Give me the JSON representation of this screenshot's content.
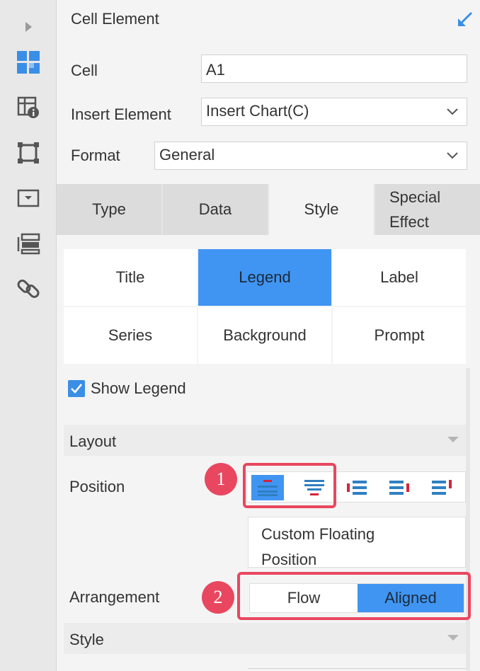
{
  "header": {
    "title": "Cell Element"
  },
  "form": {
    "cell_label": "Cell",
    "cell_value": "A1",
    "insert_label": "Insert Element",
    "insert_value": "Insert Chart(C)",
    "format_label": "Format",
    "format_value": "General"
  },
  "tabs": [
    {
      "label": "Type"
    },
    {
      "label": "Data"
    },
    {
      "label": "Style"
    },
    {
      "label_line1": "Special",
      "label_line2": "Effect"
    }
  ],
  "subtabs": [
    "Title",
    "Legend",
    "Label",
    "Series",
    "Background",
    "Prompt"
  ],
  "legend": {
    "show_label": "Show Legend",
    "show_checked": true,
    "layout_title": "Layout",
    "position_label": "Position",
    "custom_floating_line1": "Custom Floating",
    "custom_floating_line2": "Position",
    "arrangement_label": "Arrangement",
    "arrangement_options": [
      "Flow",
      "Aligned"
    ],
    "arrangement_selected": "Aligned",
    "style_title": "Style"
  },
  "annotations": {
    "badge1": "1",
    "badge2": "2"
  },
  "colors": {
    "accent": "#4095f2",
    "highlight": "#e8475f",
    "icon_blue": "#2f7fc1",
    "icon_red": "#d6243b"
  },
  "icons": {
    "rail": [
      "expand-arrow-icon",
      "cell-element-icon",
      "cell-attribute-icon",
      "float-element-icon",
      "widget-icon",
      "component-icon",
      "hyperlink-icon"
    ],
    "position": [
      "legend-top-icon",
      "legend-bottom-icon",
      "legend-left-icon",
      "legend-right-icon",
      "legend-top-right-icon"
    ]
  }
}
